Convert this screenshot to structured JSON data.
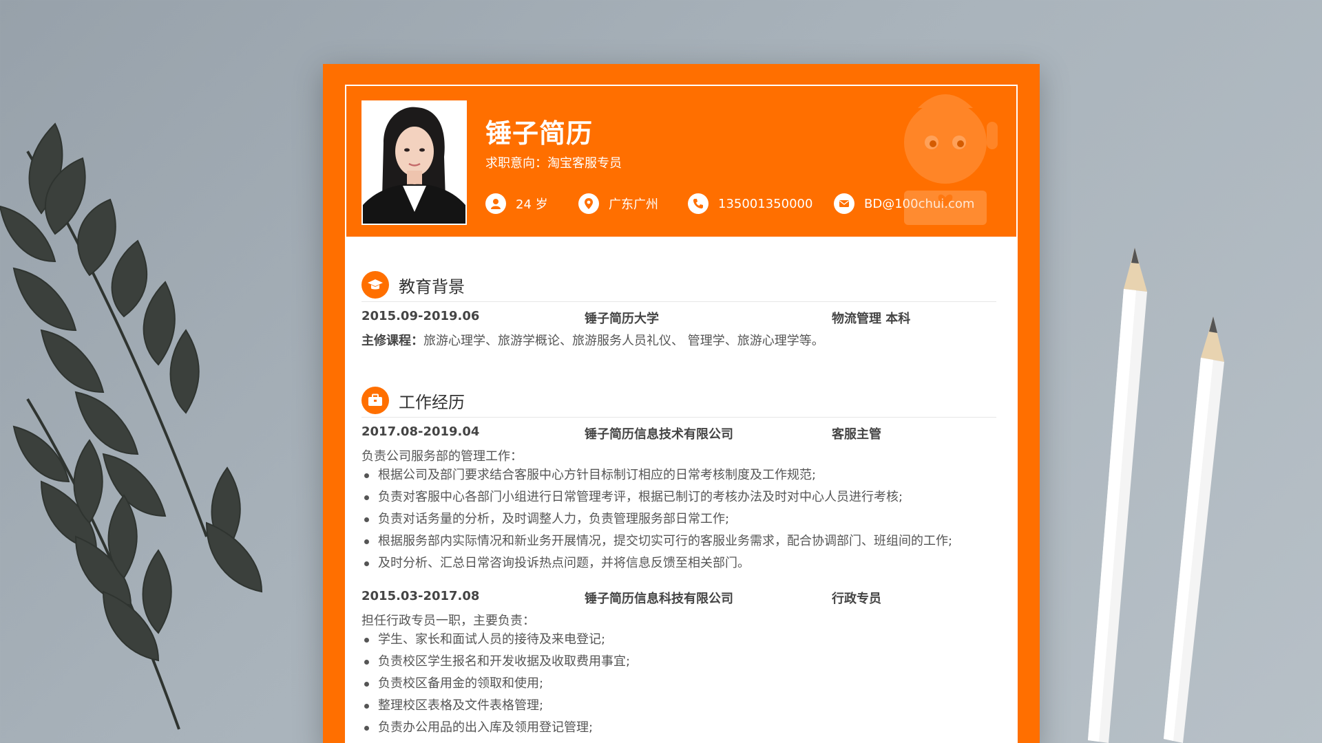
{
  "colors": {
    "accent": "#ff6f00",
    "background": "#a3adb5",
    "text": "#555555"
  },
  "header": {
    "name": "锤子简历",
    "job_intent": "求职意向：淘宝客服专员",
    "contacts": [
      {
        "icon": "person-icon",
        "text": "24 岁"
      },
      {
        "icon": "location-pin-icon",
        "text": "广东广州"
      },
      {
        "icon": "phone-icon",
        "text": "135001350000"
      },
      {
        "icon": "mail-icon",
        "text": "BD@100chui.com"
      }
    ]
  },
  "education": {
    "title": "教育背景",
    "icon": "graduation-cap-icon",
    "entry": {
      "period": "2015.09-2019.06",
      "school": "锤子简历大学",
      "major_degree": "物流管理  本科"
    },
    "courses_label": "主修课程：",
    "courses_text": "旅游心理学、旅游学概论、旅游服务人员礼仪、 管理学、旅游心理学等。"
  },
  "work": {
    "title": "工作经历",
    "icon": "briefcase-icon",
    "jobs": [
      {
        "period": "2017.08-2019.04",
        "company": "锤子简历信息技术有限公司",
        "position": "客服主管",
        "summary": "负责公司服务部的管理工作：",
        "duties": [
          "根据公司及部门要求结合客服中心方针目标制订相应的日常考核制度及工作规范;",
          "负责对客服中心各部门小组进行日常管理考评，根据已制订的考核办法及时对中心人员进行考核;",
          "负责对话务量的分析，及时调整人力，负责管理服务部日常工作;",
          "根据服务部内实际情况和新业务开展情况，提交切实可行的客服业务需求，配合协调部门、班组间的工作;",
          "及时分析、汇总日常咨询投诉热点问题，并将信息反馈至相关部门。"
        ]
      },
      {
        "period": "2015.03-2017.08",
        "company": "锤子简历信息科技有限公司",
        "position": "行政专员",
        "summary": "担任行政专员一职，主要负责：",
        "duties": [
          "学生、家长和面试人员的接待及来电登记;",
          "负责校区学生报名和开发收据及收取费用事宜;",
          "负责校区备用金的领取和使用;",
          "整理校区表格及文件表格管理;",
          "负责办公用品的出入库及领用登记管理;"
        ]
      }
    ]
  }
}
